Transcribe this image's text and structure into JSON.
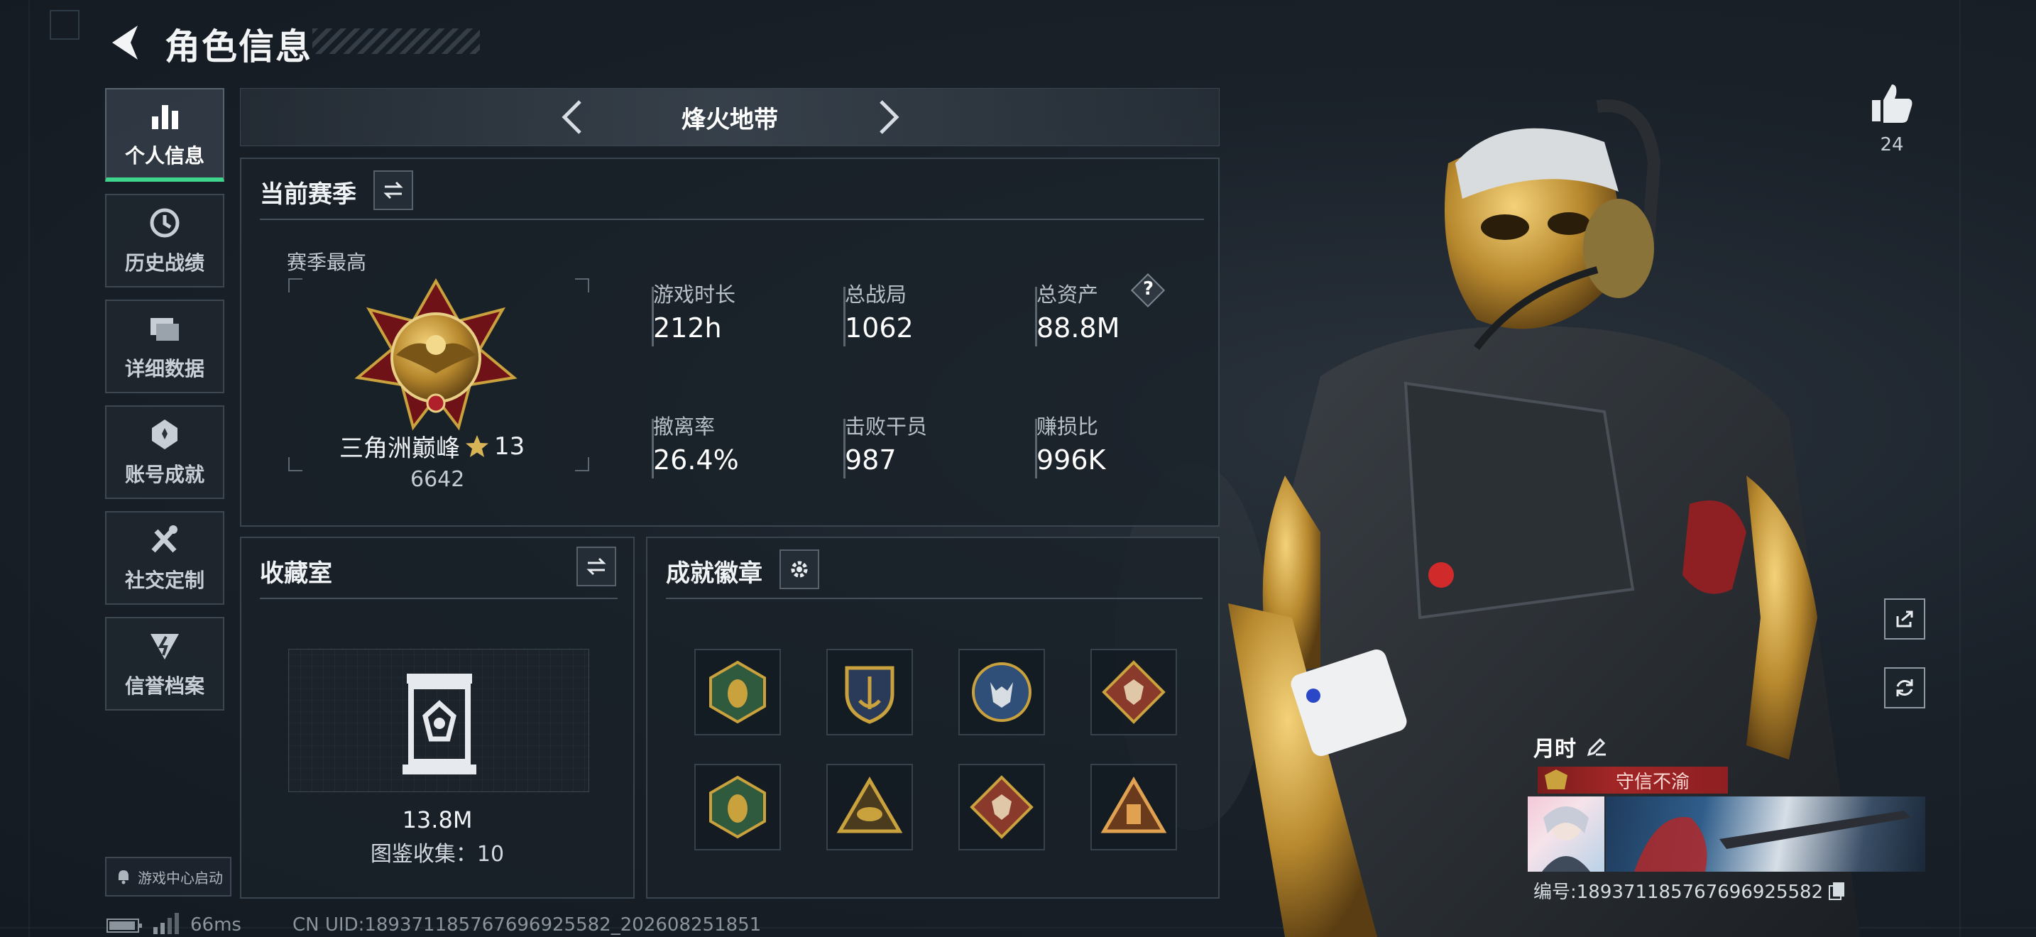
{
  "header": {
    "title": "角色信息"
  },
  "nav": {
    "items": [
      {
        "label": "个人信息",
        "icon": "bar-chart-icon",
        "active": true
      },
      {
        "label": "历史战绩",
        "icon": "clock-history-icon",
        "active": false
      },
      {
        "label": "详细数据",
        "icon": "folder-icon",
        "active": false
      },
      {
        "label": "账号成就",
        "icon": "medal-icon",
        "active": false
      },
      {
        "label": "社交定制",
        "icon": "tools-icon",
        "active": false
      },
      {
        "label": "信誉档案",
        "icon": "shield-bolt-icon",
        "active": false
      }
    ],
    "game_center": "游戏中心启动"
  },
  "mode": {
    "title": "烽火地带"
  },
  "season": {
    "title": "当前赛季",
    "best_label": "赛季最高",
    "rank_name": "三角洲巅峰",
    "rank_stars": "13",
    "rank_score": "6642",
    "stats": [
      {
        "label": "游戏时长",
        "value": "212h"
      },
      {
        "label": "总战局",
        "value": "1062"
      },
      {
        "label": "总资产",
        "value": "88.8M"
      },
      {
        "label": "撤离率",
        "value": "26.4%"
      },
      {
        "label": "击败干员",
        "value": "987"
      },
      {
        "label": "赚损比",
        "value": "996K"
      }
    ],
    "help_glyph": "?"
  },
  "collection": {
    "title": "收藏室",
    "value": "13.8M",
    "catalog_label": "图鉴收集：10"
  },
  "badges": {
    "title": "成就徽章",
    "items": [
      {
        "icon": "wasp-hexagon-badge-icon",
        "color": "#2f5a3e"
      },
      {
        "icon": "anchor-shield-badge-icon",
        "color": "#c9a13d"
      },
      {
        "icon": "wolf-circle-badge-icon",
        "color": "#2f4f78"
      },
      {
        "icon": "dragon-diamond-badge-icon",
        "color": "#8a3a2a"
      },
      {
        "icon": "wasp-hexagon-badge-icon",
        "color": "#2f5a3e"
      },
      {
        "icon": "eye-triangle-badge-icon",
        "color": "#c9a13d"
      },
      {
        "icon": "dragon-diamond-badge-icon",
        "color": "#8a3a2a"
      },
      {
        "icon": "tower-triangle-badge-icon",
        "color": "#b06a2a"
      }
    ]
  },
  "player": {
    "likes": "24",
    "name": "月时",
    "pledge": "守信不渝",
    "uid_label": "编号:18937118576769​6925582"
  },
  "status": {
    "ping": "66ms",
    "uid": "CN UID:1893711857676969​25582_202608251851"
  },
  "colors": {
    "accent_green": "#3dd68c",
    "pledge_red": "#a12626",
    "gold": "#c9a13d"
  }
}
